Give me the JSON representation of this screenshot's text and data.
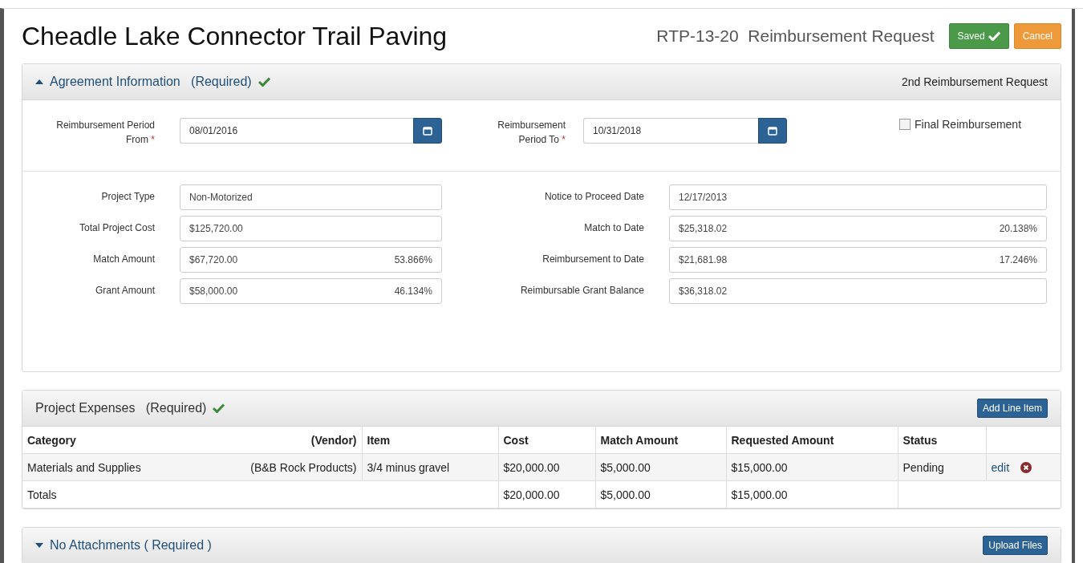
{
  "title": "Cheadle Lake Connector Trail Paving",
  "request": {
    "code": "RTP-13-20",
    "name": "Reimbursement Request"
  },
  "actions": [
    {
      "label": "Saved",
      "kind": "saved"
    },
    {
      "label": "Cancel",
      "kind": "cancel"
    }
  ],
  "agreement": {
    "title": "Agreement Information",
    "required": "(Required)",
    "complete": true,
    "expanded": true,
    "note": "2nd Reimbursement Request",
    "period_from": {
      "label": "Reimbursement Period From",
      "required_mark": "*",
      "value": "08/01/2016"
    },
    "period_to": {
      "label": "Reimbursement Period To",
      "required_mark": "*",
      "value": "10/31/2018"
    },
    "final": {
      "label": "Final Reimbursement",
      "checked": false
    },
    "left_fields": [
      {
        "label": "Project Type",
        "value": "Non-Motorized"
      },
      {
        "label": "Total Project Cost",
        "value": "$125,720.00"
      },
      {
        "label": "Match Amount",
        "value": "$67,720.00",
        "percent": "53.866%"
      },
      {
        "label": "Grant Amount",
        "value": "$58,000.00",
        "percent": "46.134%"
      }
    ],
    "right_fields": [
      {
        "label": "Notice to Proceed Date",
        "value": "12/17/2013"
      },
      {
        "label": "Match to Date",
        "value": "$25,318.02",
        "percent": "20.138%"
      },
      {
        "label": "Reimbursement to Date",
        "value": "$21,681.98",
        "percent": "17.246%"
      },
      {
        "label": "Reimbursable Grant Balance",
        "value": "$36,318.02"
      }
    ]
  },
  "expenses": {
    "title": "Project Expenses",
    "required": "(Required)",
    "complete": true,
    "add_button": "Add Line Item",
    "columns": [
      "Category",
      "(Vendor)",
      "Item",
      "Cost",
      "Match Amount",
      "Requested Amount",
      "Status"
    ],
    "rows": [
      {
        "category": "Materials and Supplies",
        "vendor": "(B&B Rock Products)",
        "item": "3/4 minus gravel",
        "cost": "$20,000.00",
        "match": "$5,000.00",
        "requested": "$15,000.00",
        "status": "Pending",
        "edit": "edit"
      }
    ],
    "totals": {
      "label": "Totals",
      "cost": "$20,000.00",
      "match": "$5,000.00",
      "requested": "$15,000.00"
    }
  },
  "attachments": {
    "title": "No Attachments ( Required )",
    "expanded": false,
    "upload_button": "Upload Files"
  }
}
